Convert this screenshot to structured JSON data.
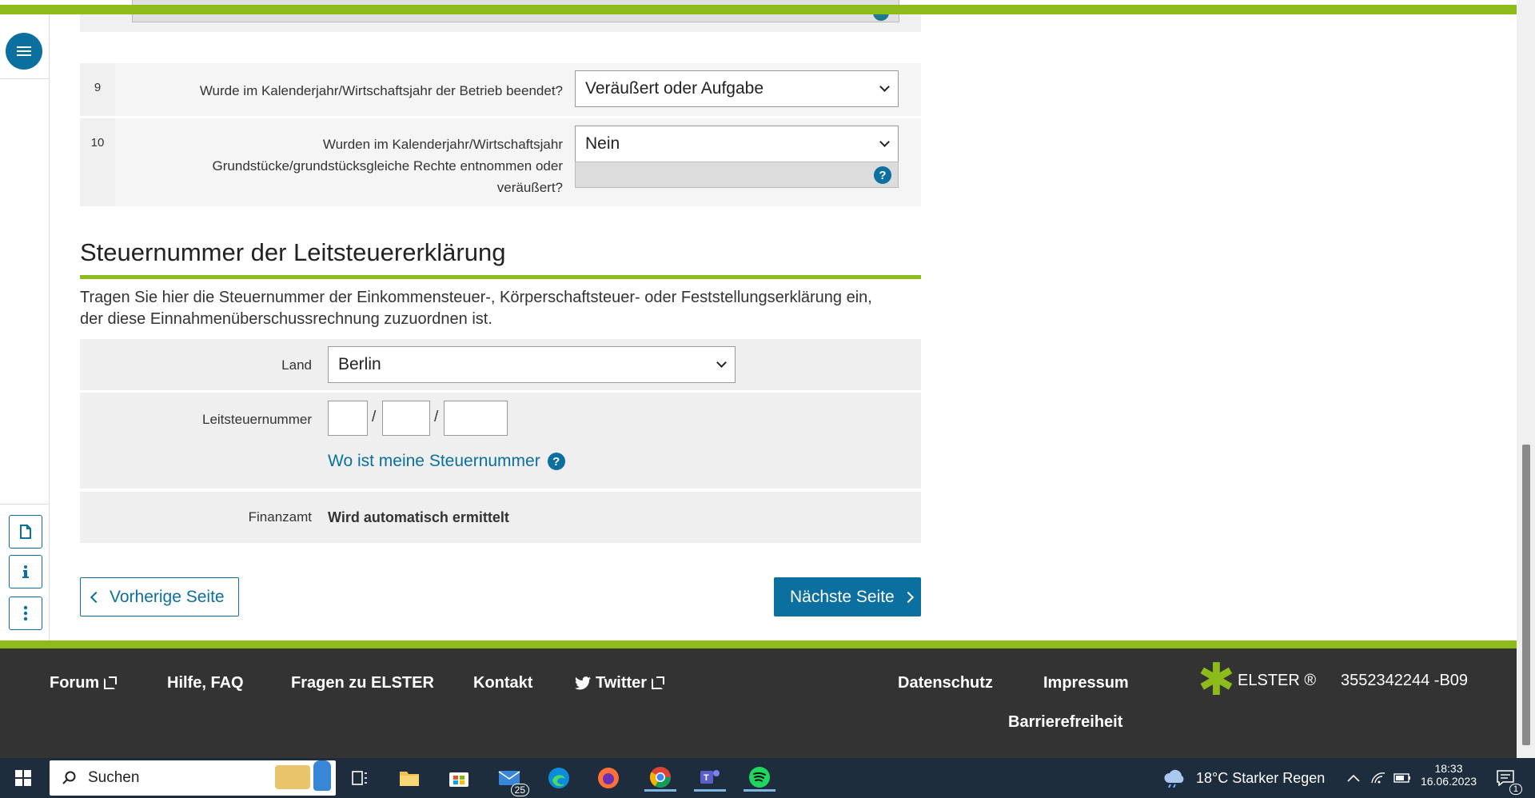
{
  "form": {
    "rows": [
      {
        "number": "9",
        "label": "Wurde im Kalenderjahr/Wirtschaftsjahr der Betrieb beendet?",
        "value": "Veräußert oder Aufgabe"
      },
      {
        "number": "10",
        "label_lines": [
          "Wurden im Kalenderjahr/Wirtschaftsjahr",
          "Grundstücke/grundstücksgleiche Rechte entnommen oder",
          "veräußert?"
        ],
        "value": "Nein",
        "help": "?"
      }
    ]
  },
  "section": {
    "title": "Steuernummer der Leitsteuererklärung",
    "description_lines": [
      "Tragen Sie hier die Steuernummer der Einkommensteuer-, Körperschaftsteuer- oder Feststellungserklärung ein,",
      "der diese Einnahmenüberschussrechnung zuzuordnen ist."
    ],
    "land_label": "Land",
    "land_value": "Berlin",
    "tin_label": "Leitsteuernummer",
    "tin_separator": "/",
    "tin_help_link": "Wo ist meine Steuernummer",
    "help": "?",
    "finanzamt_label": "Finanzamt",
    "finanzamt_value": "Wird automatisch ermittelt"
  },
  "navigation": {
    "prev_label": "Vorherige Seite",
    "next_label": "Nächste Seite"
  },
  "footer": {
    "forum": "Forum",
    "help": "Hilfe, FAQ",
    "questions": "Fragen zu ELSTER",
    "contact": "Kontakt",
    "twitter": "Twitter",
    "privacy": "Datenschutz",
    "imprint": "Impressum",
    "accessibility": "Barrierefreiheit",
    "brand": "ELSTER ®",
    "build_id": "3552342244 -B09"
  },
  "taskbar": {
    "search_placeholder": "Suchen",
    "mail_badge": "25",
    "weather": "18°C  Starker Regen",
    "time": "18:33",
    "date": "16.06.2023",
    "notification_count": "1"
  },
  "colors": {
    "accent_green": "#8dbb1a",
    "primary_blue": "#0b6f9f",
    "footer_bg": "#333333",
    "taskbar_bg": "#1e2d3d"
  }
}
